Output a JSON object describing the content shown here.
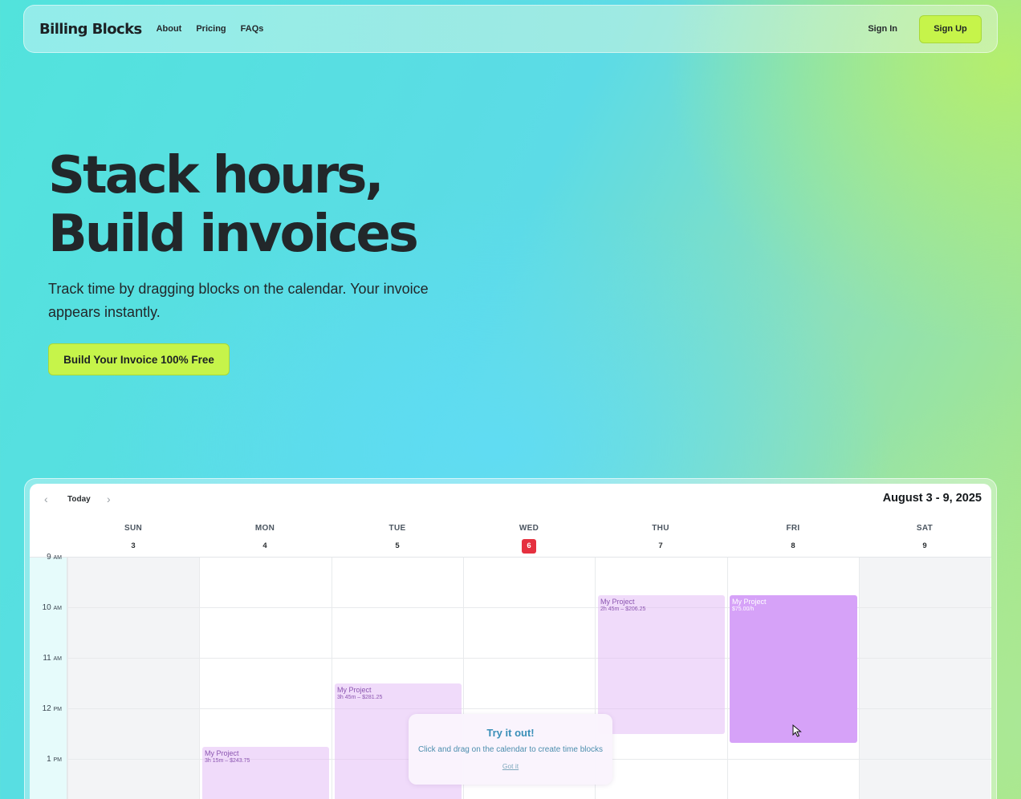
{
  "nav": {
    "brand": "Billing Blocks",
    "links": [
      "About",
      "Pricing",
      "FAQs"
    ],
    "sign_in": "Sign In",
    "sign_up": "Sign Up"
  },
  "hero": {
    "title_line1": "Stack hours,",
    "title_line2": "Build invoices",
    "subtitle": "Track time by dragging blocks on the calendar. Your invoice appears instantly.",
    "cta": "Build Your Invoice 100% Free"
  },
  "calendar": {
    "today_label": "Today",
    "range_title": "August 3 - 9, 2025",
    "days": [
      {
        "name": "SUN",
        "num": "3"
      },
      {
        "name": "MON",
        "num": "4"
      },
      {
        "name": "TUE",
        "num": "5"
      },
      {
        "name": "WED",
        "num": "6"
      },
      {
        "name": "THU",
        "num": "7"
      },
      {
        "name": "FRI",
        "num": "8"
      },
      {
        "name": "SAT",
        "num": "9"
      }
    ],
    "active_day": "6",
    "hours": [
      {
        "h": "9",
        "ap": "AM"
      },
      {
        "h": "10",
        "ap": "AM"
      },
      {
        "h": "11",
        "ap": "AM"
      },
      {
        "h": "12",
        "ap": "PM"
      },
      {
        "h": "1",
        "ap": "PM"
      }
    ],
    "blocks": [
      {
        "title": "My Project",
        "sub": "3h 15m – $243.75"
      },
      {
        "title": "My Project",
        "sub": "3h 45m – $281.25"
      },
      {
        "title": "My Project",
        "sub": "2h 45m – $206.25"
      },
      {
        "title": "My Project",
        "sub": "$75.00/h"
      }
    ]
  },
  "popup": {
    "title": "Try it out!",
    "text": "Click and drag on the calendar to create time blocks",
    "link": "Got it"
  },
  "colors": {
    "accent_lime": "#c6f44a",
    "block_purple": "#d6a2f8",
    "today_red": "#e5303f",
    "popup_blue": "#3a8fb8"
  }
}
